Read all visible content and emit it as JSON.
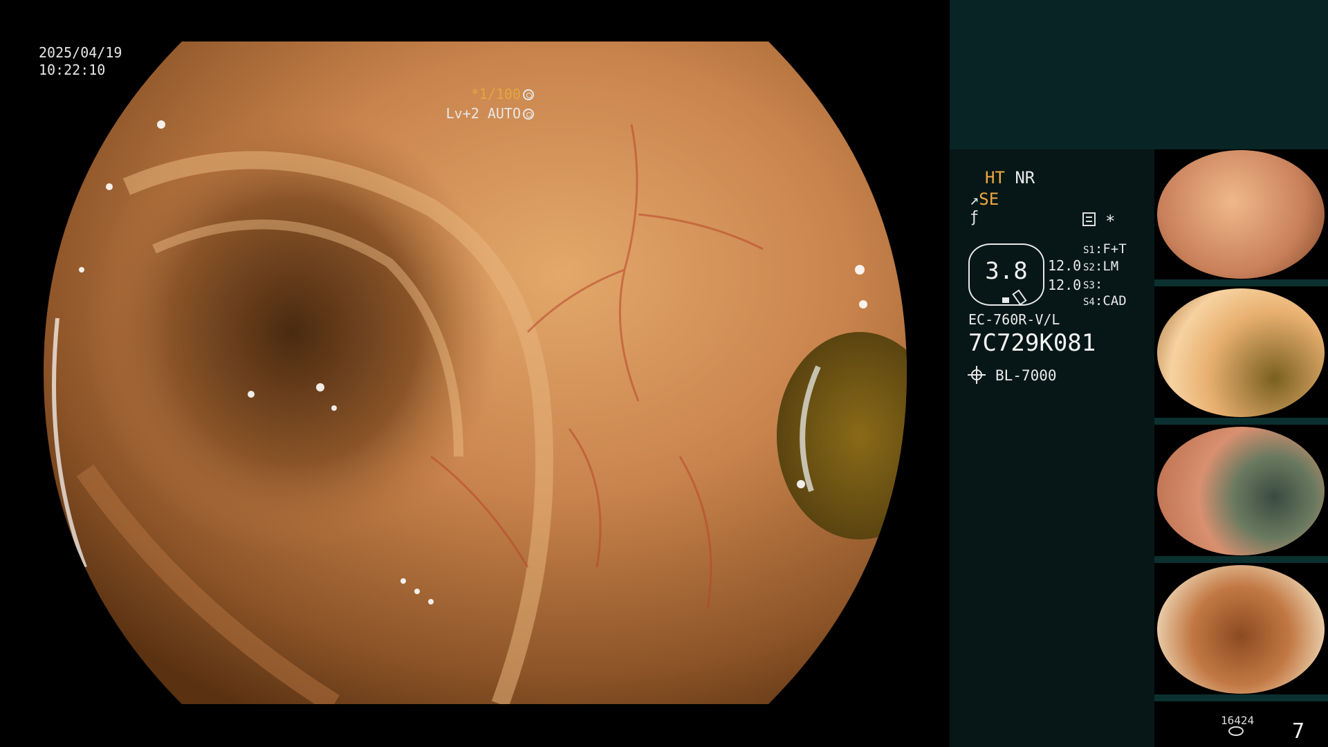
{
  "overlay": {
    "date": "2025/04/19",
    "time": "10:22:10",
    "shutter": "*1/100",
    "level": "Lv+2 AUTO"
  },
  "info": {
    "mode_ht": "HT",
    "mode_nr": "NR",
    "se": "SE",
    "zoom_value": "3.8",
    "zoom_a": "12.0",
    "zoom_b": "12.0",
    "switches": [
      {
        "id": "S1",
        "value": "F+T"
      },
      {
        "id": "S2",
        "value": "LM"
      },
      {
        "id": "S3",
        "value": ""
      },
      {
        "id": "S4",
        "value": "CAD"
      }
    ],
    "scope_model": "EC-760R-V/L",
    "scope_serial": "7C729K081",
    "light_source": "BL-7000",
    "image_count": "16424",
    "page_number": "7"
  },
  "icons": [
    "shutter-icon",
    "auto-iris-icon",
    "se-icon",
    "f-icon",
    "panel-icon",
    "star-icon",
    "light-icon",
    "disk-icon"
  ],
  "colors": {
    "accent": "#f0a840",
    "panel_top": "#092424",
    "panel_info": "#071717",
    "thumb_strip": "#0b3030"
  }
}
